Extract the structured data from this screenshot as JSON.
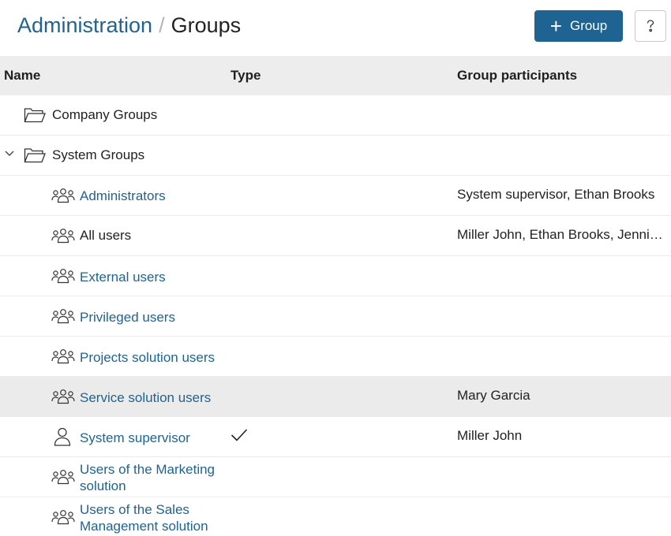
{
  "breadcrumb": {
    "parent": "Administration",
    "separator": "/",
    "current": "Groups"
  },
  "toolbar": {
    "add_button_label": "Group",
    "help_icon": "help-icon"
  },
  "table": {
    "columns": {
      "name": "Name",
      "type": "Type",
      "participants": "Group participants"
    },
    "rows": [
      {
        "name": "Company Groups",
        "kind": "folder",
        "participants": ""
      },
      {
        "name": "System Groups",
        "kind": "folder-expanded",
        "participants": ""
      },
      {
        "name": "Administrators",
        "kind": "group",
        "participants": "System supervisor, Ethan Brooks"
      },
      {
        "name": "All users",
        "kind": "group",
        "participants": "Miller John, Ethan Brooks, Jennifer"
      },
      {
        "name": "External users",
        "kind": "group",
        "participants": ""
      },
      {
        "name": "Privileged users",
        "kind": "group",
        "participants": ""
      },
      {
        "name": "Projects solution users",
        "kind": "group",
        "participants": ""
      },
      {
        "name": "Service solution users",
        "kind": "group",
        "participants": "Mary Garcia",
        "selected": true
      },
      {
        "name": "System supervisor",
        "kind": "user",
        "type_checked": true,
        "participants": "Miller John"
      },
      {
        "name": "Users of the Marketing solution",
        "kind": "group",
        "participants": ""
      },
      {
        "name": "Users of the Sales Management solution",
        "kind": "group",
        "participants": ""
      }
    ]
  },
  "colors": {
    "accent": "#1f6392",
    "header_bg": "#ededed",
    "selected_row_bg": "#ebebeb"
  }
}
